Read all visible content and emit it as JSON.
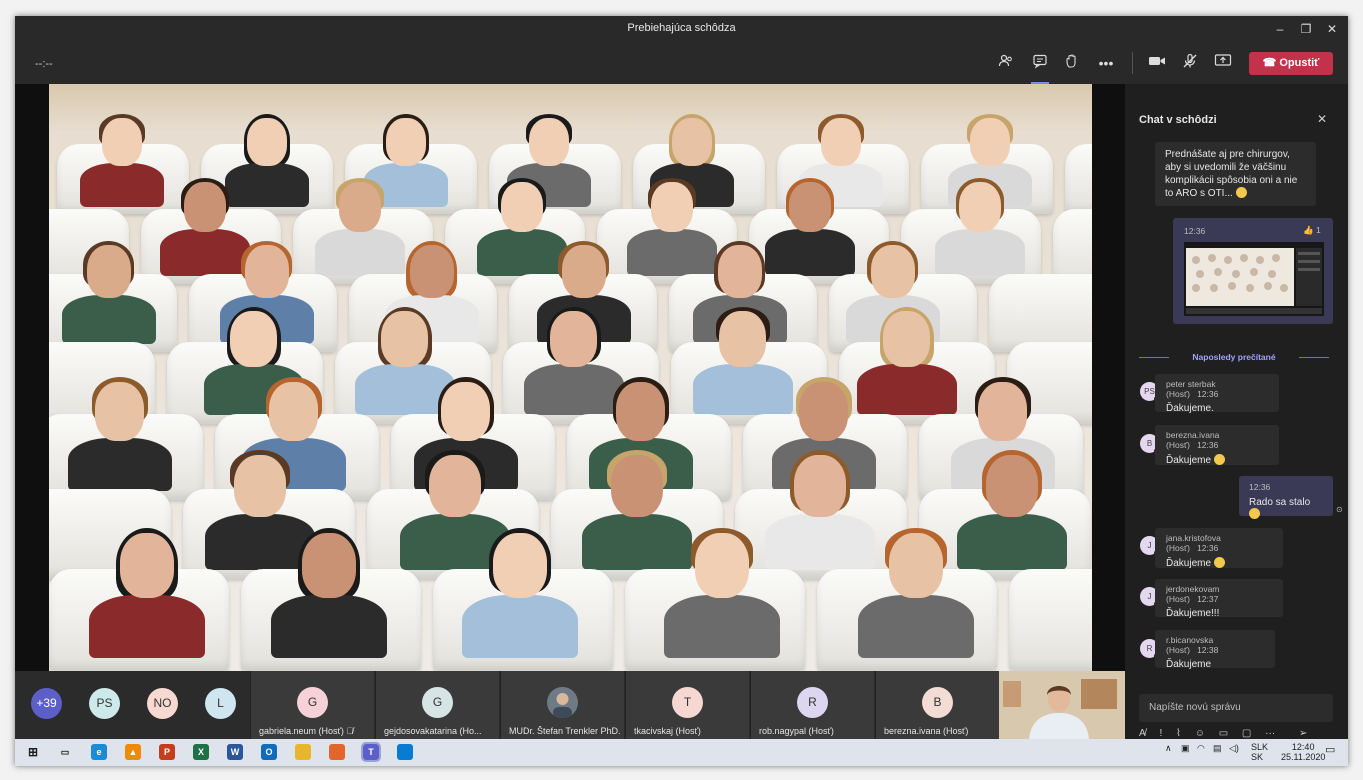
{
  "window": {
    "title": "Prebiehajúca schôdza"
  },
  "toolbar": {
    "timer": "--:--",
    "leave_label": "Opustiť",
    "icons": [
      "people-icon",
      "chat-icon",
      "raise-hand-icon",
      "more-icon",
      "camera-icon",
      "mic-off-icon",
      "share-screen-icon"
    ]
  },
  "participants": {
    "overflow": "+39",
    "avatars": [
      {
        "initials": "PS",
        "color": "#cde9e9"
      },
      {
        "initials": "NO",
        "color": "#f7d9d2"
      },
      {
        "initials": "L",
        "color": "#cfe5ef"
      }
    ],
    "tiles": [
      {
        "initials": "G",
        "name": "gabriela.neum (Hosť)",
        "color": "#f6d2d8"
      },
      {
        "initials": "G",
        "name": "gejdosovakatarina (Ho...",
        "color": "#d7e4e6"
      },
      {
        "initials": "",
        "name": "MUDr. Štefan Trenkler PhD.",
        "color": "#8a8a8a"
      },
      {
        "initials": "T",
        "name": "tkacivskaj (Hosť)",
        "color": "#f7d7d1"
      },
      {
        "initials": "R",
        "name": "rob.nagypal (Hosť)",
        "color": "#dcd6f0"
      },
      {
        "initials": "B",
        "name": "berezna.ivana (Hosť)",
        "color": "#f3dcd4"
      }
    ]
  },
  "chat": {
    "title": "Chat v schôdzi",
    "first_message": "Prednášate aj pre chirurgov, aby si uvedomili že väčšinu komplikácii spôsobia oni a nie to ARO s OTI...",
    "image_message": {
      "time": "12:36",
      "reaction": "1"
    },
    "divider": "Naposledy prečítané",
    "messages": [
      {
        "initials": "PS",
        "author": "peter sterbak (Hosť)",
        "time": "12:36",
        "text": "Ďakujeme."
      },
      {
        "initials": "B",
        "author": "berezna.ivana (Hosť)",
        "time": "12:36",
        "text": "Ďakujeme"
      },
      {
        "initials": "J",
        "author": "jana.kristofova (Hosť)",
        "time": "12:36",
        "text": "Ďakujeme"
      },
      {
        "initials": "J",
        "author": "jerdonekovam (Hosť)",
        "time": "12:37",
        "text": "Ďakujeme!!!"
      },
      {
        "initials": "R",
        "author": "r.bicanovska (Hosť)",
        "time": "12:38",
        "text": "Ďakujeme"
      }
    ],
    "own_message": {
      "time": "12:36",
      "text": "Rado sa stalo"
    },
    "composer_placeholder": "Napíšte novú správu"
  },
  "taskbar": {
    "language": "SLK",
    "language_sub": "SK",
    "time": "12:40",
    "date": "25.11.2020",
    "apps": [
      {
        "name": "edge",
        "color": "#1c8bd6",
        "label": "e"
      },
      {
        "name": "vlc",
        "color": "#f08a00",
        "label": "▲"
      },
      {
        "name": "powerpoint",
        "color": "#c43e1c",
        "label": "P"
      },
      {
        "name": "excel",
        "color": "#1e7145",
        "label": "X"
      },
      {
        "name": "word",
        "color": "#2b579a",
        "label": "W"
      },
      {
        "name": "outlook",
        "color": "#0f6cbd",
        "label": "O"
      },
      {
        "name": "file-explorer",
        "color": "#e8b52f",
        "label": ""
      },
      {
        "name": "firefox",
        "color": "#e0662c",
        "label": ""
      },
      {
        "name": "teams",
        "color": "#5b5fc7",
        "label": "T"
      },
      {
        "name": "photos",
        "color": "#0a7bd2",
        "label": ""
      }
    ]
  }
}
